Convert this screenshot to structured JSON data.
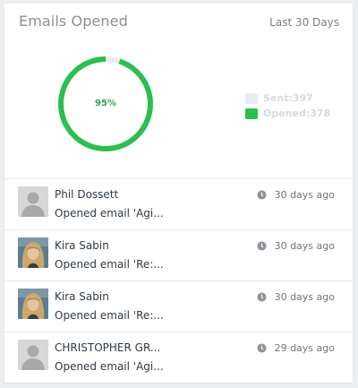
{
  "widget": {
    "title": "Emails Opened",
    "period": "Last 30 Days"
  },
  "chart": {
    "percent_label": "95%",
    "opened_fraction": 0.95,
    "colors": {
      "opened": "#2cbe4e",
      "sent": "#e8ecef"
    },
    "legend": [
      {
        "label": "Sent:397",
        "color": "#e8ecef"
      },
      {
        "label": "Opened:378",
        "color": "#2cbe4e"
      }
    ]
  },
  "feed": {
    "items": [
      {
        "name": "Phil Dossett",
        "description": "Opened email 'Agi...",
        "time": "30 days ago",
        "avatar": "placeholder-avatar"
      },
      {
        "name": "Kira Sabin",
        "description": "Opened email 'Re:...",
        "time": "30 days ago",
        "avatar": "photo-avatar"
      },
      {
        "name": "Kira Sabin",
        "description": "Opened email 'Re:...",
        "time": "30 days ago",
        "avatar": "photo-avatar"
      },
      {
        "name": "CHRISTOPHER GR...",
        "description": "Opened email 'Agi...",
        "time": "29 days ago",
        "avatar": "placeholder-avatar"
      }
    ]
  }
}
